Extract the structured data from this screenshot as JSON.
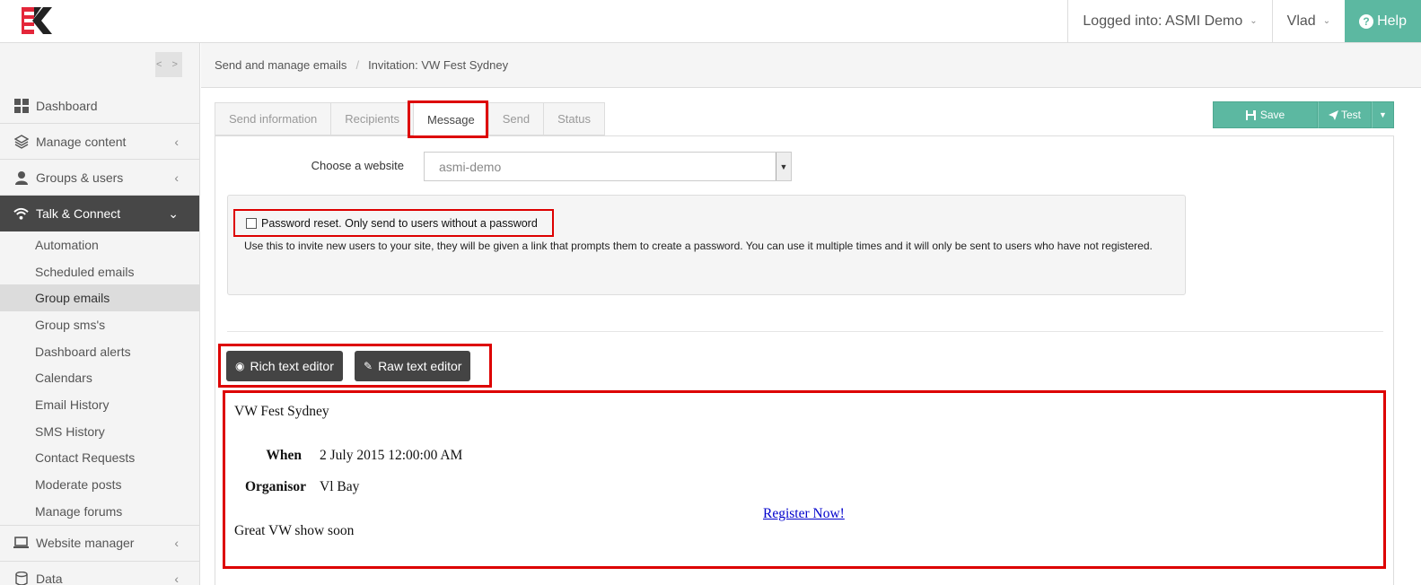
{
  "header": {
    "logged_in_label": "Logged into: ASMI Demo",
    "user_label": "Vlad",
    "help_label": "Help"
  },
  "sidebar": {
    "collapse_label": "< >",
    "items": [
      {
        "label": "Dashboard",
        "icon": "dashboard-icon"
      },
      {
        "label": "Manage content",
        "icon": "layers-icon"
      },
      {
        "label": "Groups & users",
        "icon": "user-icon"
      },
      {
        "label": "Talk & Connect",
        "icon": "wifi-icon"
      },
      {
        "label": "Website manager",
        "icon": "laptop-icon"
      },
      {
        "label": "Data",
        "icon": "database-icon"
      }
    ],
    "submenu": [
      "Automation",
      "Scheduled emails",
      "Group emails",
      "Group sms's",
      "Dashboard alerts",
      "Calendars",
      "Email History",
      "SMS History",
      "Contact Requests",
      "Moderate posts",
      "Manage forums"
    ]
  },
  "breadcrumb": {
    "parent": "Send and manage emails",
    "current": "Invitation: VW Fest Sydney"
  },
  "tabs": [
    "Send information",
    "Recipients",
    "Message",
    "Send",
    "Status"
  ],
  "actions": {
    "save_label": "Save",
    "test_label": "Test"
  },
  "website": {
    "label": "Choose a website",
    "value": "asmi-demo"
  },
  "password_reset": {
    "checkbox_label": "Password reset. Only send to users without a password",
    "description": "Use this to invite new users to your site, they will be given a link that prompts them to create a password. You can use it multiple times and it will only be sent to users who have not registered."
  },
  "editor_modes": {
    "rich_label": "Rich text editor",
    "raw_label": "Raw text editor"
  },
  "message": {
    "title": "VW Fest Sydney",
    "when_label": "When",
    "when_value": "2 July 2015 12:00:00 AM",
    "organisor_label": "Organisor",
    "organisor_value": "Vl Bay",
    "link_text": "Register Now!",
    "footer": "Great VW show soon"
  },
  "colors": {
    "accent": "#5cb8a1",
    "active_menu": "#474747",
    "highlight": "#dd0000"
  }
}
